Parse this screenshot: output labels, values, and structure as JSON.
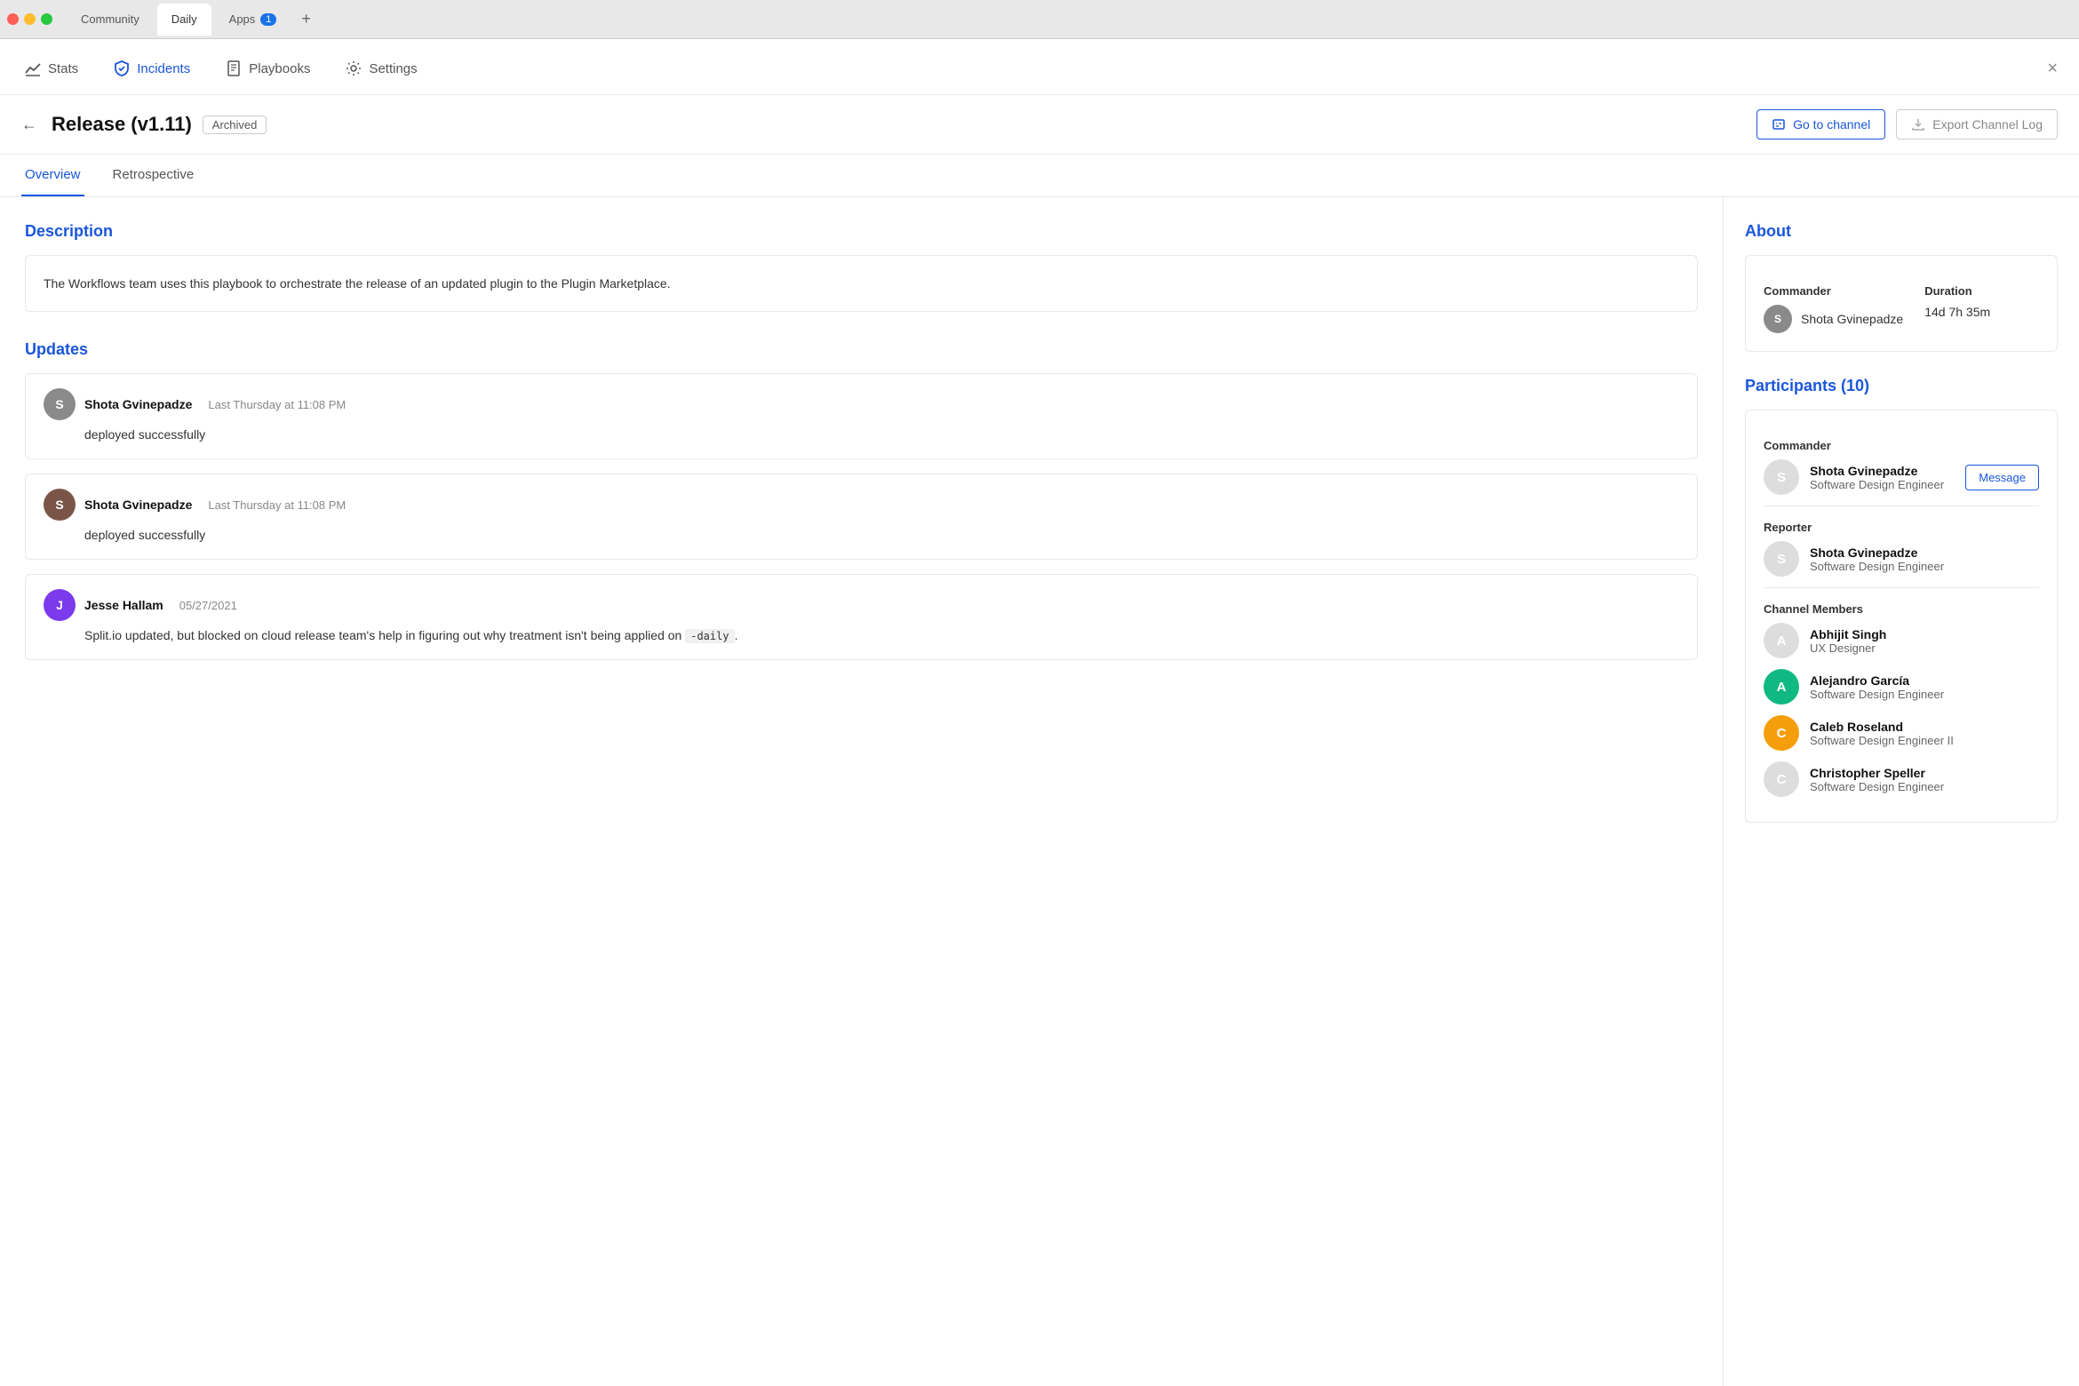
{
  "browser": {
    "tabs": [
      {
        "label": "Community",
        "active": false,
        "badge": null
      },
      {
        "label": "Daily",
        "active": true,
        "badge": null
      },
      {
        "label": "Apps",
        "active": false,
        "badge": "1"
      }
    ],
    "new_tab_label": "+"
  },
  "top_nav": {
    "items": [
      {
        "id": "stats",
        "label": "Stats",
        "icon": "chart-icon",
        "active": false
      },
      {
        "id": "incidents",
        "label": "Incidents",
        "icon": "shield-icon",
        "active": true
      },
      {
        "id": "playbooks",
        "label": "Playbooks",
        "icon": "book-icon",
        "active": false
      },
      {
        "id": "settings",
        "label": "Settings",
        "icon": "gear-icon",
        "active": false
      }
    ],
    "close_label": "×"
  },
  "incident": {
    "title": "Release (v1.11)",
    "status": "Archived",
    "back_label": "←",
    "actions": {
      "go_to_channel": "Go to channel",
      "export_log": "Export Channel Log"
    }
  },
  "tabs": [
    {
      "id": "overview",
      "label": "Overview",
      "active": true
    },
    {
      "id": "retrospective",
      "label": "Retrospective",
      "active": false
    }
  ],
  "description": {
    "title": "Description",
    "text": "The Workflows team uses this playbook to orchestrate the release of an updated plugin to the Plugin Marketplace."
  },
  "updates": {
    "title": "Updates",
    "items": [
      {
        "author": "Shota Gvinepadze",
        "time": "Last Thursday at 11:08 PM",
        "text": "deployed successfully",
        "avatar_letter": "S",
        "avatar_type": "gray"
      },
      {
        "author": "Shota Gvinepadze",
        "time": "Last Thursday at 11:08 PM",
        "text": "deployed successfully",
        "avatar_letter": "S",
        "avatar_type": "brown"
      },
      {
        "author": "Jesse Hallam",
        "time": "05/27/2021",
        "text_before": "Split.io updated, but blocked on cloud release team's help in figuring out why treatment isn't being applied on ",
        "code": "-daily",
        "text_after": ".",
        "avatar_letter": "J",
        "avatar_type": "purple"
      }
    ]
  },
  "about": {
    "title": "About",
    "commander_label": "Commander",
    "duration_label": "Duration",
    "commander_name": "Shota Gvinepadze",
    "duration_value": "14d 7h 35m"
  },
  "participants": {
    "title": "Participants (10)",
    "commander_role": "Commander",
    "reporter_role": "Reporter",
    "members_role": "Channel Members",
    "commander": {
      "name": "Shota Gvinepadze",
      "role": "Software Design Engineer",
      "avatar_letter": "S",
      "avatar_type": "gray"
    },
    "reporter": {
      "name": "Shota Gvinepadze",
      "role": "Software Design Engineer",
      "avatar_letter": "S",
      "avatar_type": "brown"
    },
    "message_label": "Message",
    "members": [
      {
        "name": "Abhijit Singh",
        "role": "UX Designer",
        "avatar_letter": "A",
        "avatar_type": "gray"
      },
      {
        "name": "Alejandro García",
        "role": "Software Design Engineer",
        "avatar_letter": "A",
        "avatar_type": "green"
      },
      {
        "name": "Caleb Roseland",
        "role": "Software Design Engineer II",
        "avatar_letter": "C",
        "avatar_type": "orange"
      },
      {
        "name": "Christopher Speller",
        "role": "Software Design Engineer",
        "avatar_letter": "C",
        "avatar_type": "gray"
      }
    ]
  }
}
